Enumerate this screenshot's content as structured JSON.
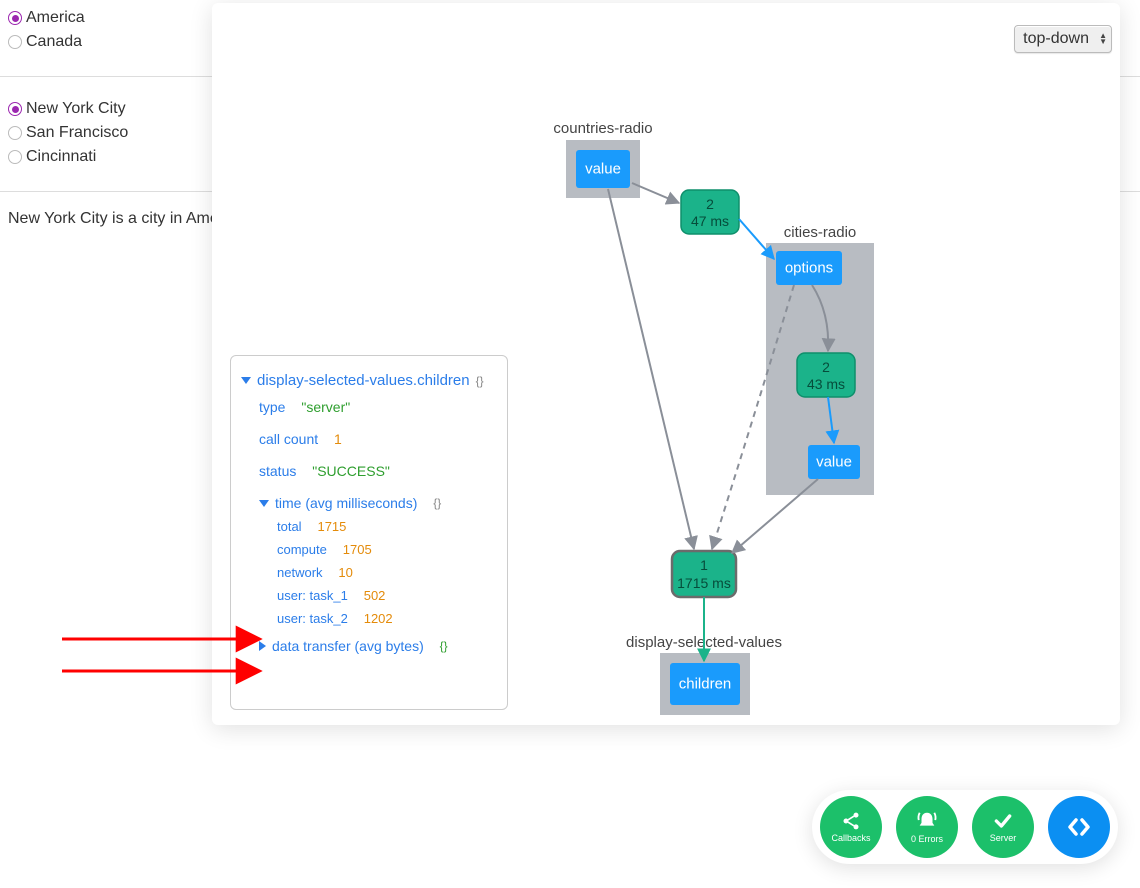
{
  "radio_countries": {
    "options": [
      "America",
      "Canada"
    ],
    "selected": "America"
  },
  "radio_cities": {
    "options": [
      "New York City",
      "San Francisco",
      "Cincinnati"
    ],
    "selected": "New York City"
  },
  "sentence": "New York City is a city in America",
  "layout_select": {
    "label": "top-down"
  },
  "info_card": {
    "title": "display-selected-values.children",
    "type_key": "type",
    "type_val": "\"server\"",
    "callcount_key": "call count",
    "callcount_val": "1",
    "status_key": "status",
    "status_val": "\"SUCCESS\"",
    "time_header": "time (avg milliseconds)",
    "time": {
      "total_key": "total",
      "total_val": "1715",
      "compute_key": "compute",
      "compute_val": "1705",
      "network_key": "network",
      "network_val": "10",
      "task1_key": "user: task_1",
      "task1_val": "502",
      "task2_key": "user: task_2",
      "task2_val": "1202"
    },
    "data_transfer_header": "data transfer (avg bytes)"
  },
  "graph": {
    "countries_radio_label": "countries-radio",
    "countries_value": "value",
    "cities_radio_label": "cities-radio",
    "cities_options": "options",
    "cities_value": "value",
    "cb1_count": "2",
    "cb1_time": "47 ms",
    "cb2_count": "2",
    "cb2_time": "43 ms",
    "cb3_count": "1",
    "cb3_time": "1715 ms",
    "display_label": "display-selected-values",
    "display_children": "children"
  },
  "toolbar": {
    "callbacks": "Callbacks",
    "errors": "0 Errors",
    "server": "Server"
  }
}
